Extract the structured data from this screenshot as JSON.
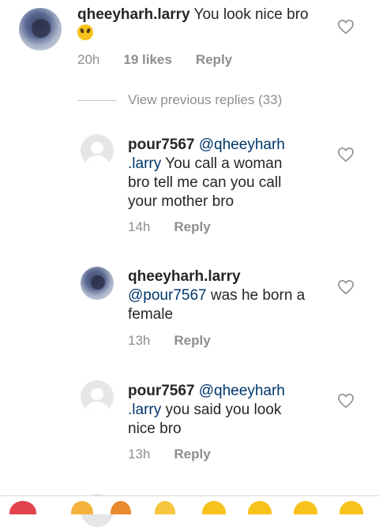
{
  "comments": [
    {
      "username": "qheeyharh.larry",
      "text": "You look nice bro",
      "emoji": "laughing-face",
      "time": "20h",
      "likes": "19 likes",
      "reply": "Reply"
    }
  ],
  "view_previous": "View previous replies (33)",
  "replies": [
    {
      "username": "pour7567",
      "mention": "@qheeyharh",
      "mention2": ".larry",
      "text_line1": " You call a woman",
      "text_line2": "bro tell me can you call",
      "text_line3": "your mother bro",
      "time": "14h",
      "reply": "Reply"
    },
    {
      "username": "qheeyharh.larry",
      "mention": "@pour7567",
      "text_line1": " was he born a",
      "text_line2": "female",
      "time": "13h",
      "reply": "Reply"
    },
    {
      "username": "pour7567",
      "mention": "@qheeyharh",
      "mention2": ".larry",
      "text_line1": " you said you look",
      "text_line2": "nice bro",
      "time": "13h",
      "reply": "Reply"
    }
  ],
  "icons": {
    "heart": "heart-outline-icon",
    "accent": "#e0434c"
  }
}
